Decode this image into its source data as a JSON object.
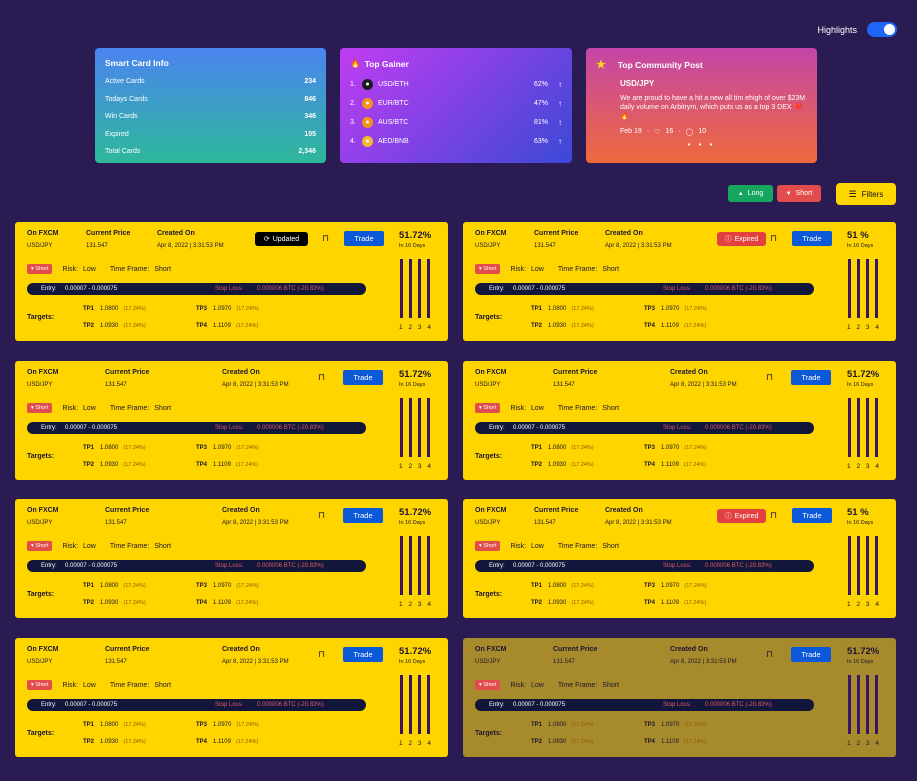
{
  "header": {
    "highlights_label": "Highlights"
  },
  "smart_card": {
    "title": "Smart Card Info",
    "rows": [
      {
        "label": "Active Cards",
        "value": "234"
      },
      {
        "label": "Todays Cards",
        "value": "846"
      },
      {
        "label": "Win Cards",
        "value": "346"
      },
      {
        "label": "Expired",
        "value": "105"
      },
      {
        "label": "Total Cards",
        "value": "2,346"
      }
    ]
  },
  "top_gainer": {
    "title": "Top Gainer",
    "rows": [
      {
        "n": "1.",
        "pair": "USD/ETH",
        "pct": "62%",
        "color": "#1b1b1b"
      },
      {
        "n": "2.",
        "pair": "EUR/BTC",
        "pct": "47%",
        "color": "#f7931a"
      },
      {
        "n": "3.",
        "pair": "AUS/BTC",
        "pct": "81%",
        "color": "#f7931a"
      },
      {
        "n": "4.",
        "pair": "AED/BNB",
        "pct": "63%",
        "color": "#f3ba2f"
      }
    ]
  },
  "community": {
    "title": "Top Community Post",
    "pair": "USD/JPY",
    "text": "We are proud to have a hit a new all tim ehigh of over $23M daily volume on Arbitrym, which puts us as a top 3 DEX ❤️🔥",
    "date": "Feb 19",
    "likes": "16",
    "comments": "10"
  },
  "filters": {
    "long": "Long",
    "short": "Short",
    "filters": "Filters"
  },
  "card_labels": {
    "exchange": "On FXCM",
    "pair": "USD/JPY",
    "current_price": "Current Price",
    "price": "131.547",
    "created_on": "Created On",
    "date": "Apr 8, 2022 | 3:31:53 PM",
    "trade": "Trade",
    "days": "In 16 Days",
    "short": "Short",
    "risk": "Risk:",
    "risk_val": "Low",
    "tf": "Time Frame:",
    "tf_val": "Short",
    "entry": "Entry:",
    "entry_val": "0.00007 - 0.000075",
    "stop": "Stop Loss:",
    "stop_val": "0.000006 BTC (-20.83%)",
    "targets": "Targets:",
    "tp1": "TP1",
    "tp1v": "1.0800",
    "tp1p": "(17.24%)",
    "tp2": "TP2",
    "tp2v": "1.0930",
    "tp2p": "(17.24%)",
    "tp3": "TP3",
    "tp3v": "1.0970",
    "tp3p": "(17.24%)",
    "tp4": "TP4",
    "tp4v": "1.1109",
    "tp4p": "(17.24%)",
    "b1": "1",
    "b2": "2",
    "b3": "3",
    "b4": "4",
    "updated": "Updated",
    "expired": "Expired"
  },
  "cards": [
    {
      "pct": "51.72%",
      "badge": "updated",
      "dim": false
    },
    {
      "pct": "51 %",
      "badge": "expired",
      "dim": false
    },
    {
      "pct": "51.72%",
      "badge": "",
      "dim": false
    },
    {
      "pct": "51.72%",
      "badge": "",
      "dim": false
    },
    {
      "pct": "51.72%",
      "badge": "",
      "dim": false
    },
    {
      "pct": "51 %",
      "badge": "expired",
      "dim": false
    },
    {
      "pct": "51.72%",
      "badge": "",
      "dim": false
    },
    {
      "pct": "51.72%",
      "badge": "",
      "dim": true
    }
  ]
}
